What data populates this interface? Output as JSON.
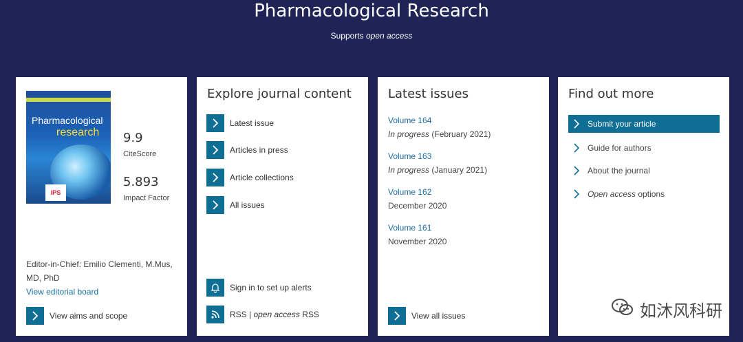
{
  "header": {
    "title": "Pharmacological Research",
    "subtitle_prefix": "Supports ",
    "subtitle_em": "open access"
  },
  "card_journal": {
    "cover": {
      "title_line1": "Pharmacological",
      "title_line2": "research",
      "logo_text": "IPS"
    },
    "citescore": {
      "value": "9.9",
      "label": "CiteScore"
    },
    "impact": {
      "value": "5.893",
      "label": "Impact Factor"
    },
    "editor_text": "Editor-in-Chief: Emilio Clementi, M.Mus, MD, PhD",
    "editorial_board_link": "View editorial board",
    "aims_scope_label": "View aims and scope"
  },
  "card_explore": {
    "heading": "Explore journal content",
    "items": [
      {
        "label": "Latest issue"
      },
      {
        "label": "Articles in press"
      },
      {
        "label": "Article collections"
      },
      {
        "label": "All issues"
      }
    ],
    "alerts_label": "Sign in to set up alerts",
    "rss_prefix": "RSS | ",
    "rss_em": "open access",
    "rss_suffix": " RSS"
  },
  "card_latest": {
    "heading": "Latest issues",
    "issues": [
      {
        "volume": "Volume 164",
        "status_em": "In progress",
        "date": " (February 2021)"
      },
      {
        "volume": "Volume 163",
        "status_em": "In progress",
        "date": " (January 2021)"
      },
      {
        "volume": "Volume 162",
        "status_em": "",
        "date": "December 2020"
      },
      {
        "volume": "Volume 161",
        "status_em": "",
        "date": "November 2020"
      }
    ],
    "view_all_label": "View all issues"
  },
  "card_find": {
    "heading": "Find out more",
    "items": [
      {
        "label": "Submit your article"
      },
      {
        "label": "Guide for authors"
      },
      {
        "label": "About the journal"
      },
      {
        "label_em": "Open access",
        "label_suffix": " options"
      }
    ]
  },
  "watermark": {
    "text": "如沐风科研"
  },
  "colors": {
    "background": "#1f2356",
    "accent": "#0e6e93",
    "link": "#1b6fa3"
  }
}
